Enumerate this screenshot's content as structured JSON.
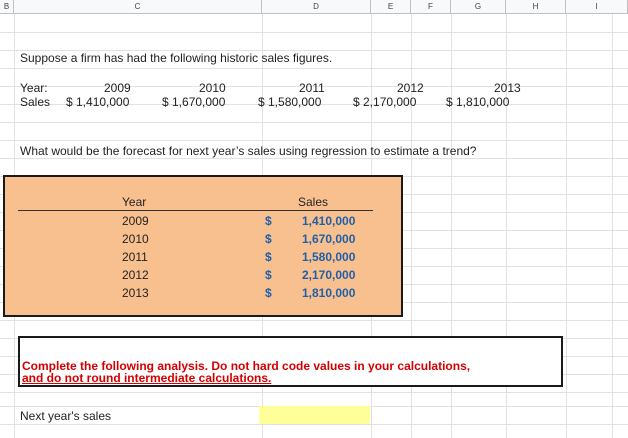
{
  "columns": [
    "B",
    "C",
    "D",
    "E",
    "F",
    "G",
    "H",
    "I"
  ],
  "intro": "Suppose a firm has had the following historic sales figures.",
  "historic": {
    "year_label": "Year:",
    "sales_label": "Sales",
    "years": [
      "2009",
      "2010",
      "2011",
      "2012",
      "2013"
    ],
    "sales": [
      "$ 1,410,000",
      "$ 1,670,000",
      "$ 1,580,000",
      "$ 2,170,000",
      "$ 1,810,000"
    ]
  },
  "question": "What would be the forecast for next year’s sales using regression to estimate a trend?",
  "table": {
    "year_header": "Year",
    "sales_header": "Sales",
    "currency": "$",
    "rows": [
      {
        "year": "2009",
        "sales": "1,410,000"
      },
      {
        "year": "2010",
        "sales": "1,670,000"
      },
      {
        "year": "2011",
        "sales": "1,580,000"
      },
      {
        "year": "2012",
        "sales": "2,170,000"
      },
      {
        "year": "2013",
        "sales": "1,810,000"
      }
    ]
  },
  "instruction": {
    "line1": "Complete the following analysis. Do not hard code values in your calculations,",
    "line2": "and do not round intermediate calculations."
  },
  "next_year_label": "Next year's sales",
  "next_year_value": "",
  "colors": {
    "box_fill": "#f9c08f",
    "sales_text": "#1f5fa8",
    "warning_text": "#d40000",
    "input_fill": "#ffff99"
  }
}
